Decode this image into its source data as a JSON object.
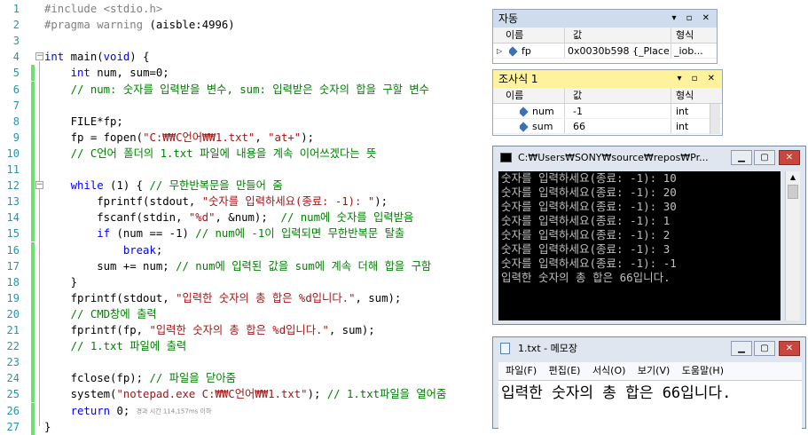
{
  "editor": {
    "line_numbers": [
      "1",
      "2",
      "3",
      "4",
      "5",
      "6",
      "7",
      "8",
      "9",
      "10",
      "11",
      "12",
      "13",
      "14",
      "15",
      "16",
      "17",
      "18",
      "19",
      "20",
      "21",
      "22",
      "23",
      "24",
      "25",
      "26",
      "27"
    ],
    "lines": [
      [
        {
          "t": "#include <stdio.h>",
          "c": "pp"
        }
      ],
      [
        {
          "t": "#pragma warning ",
          "c": "pp"
        },
        {
          "t": "(aisble:4996)",
          "c": ""
        }
      ],
      [],
      [
        {
          "t": "int",
          "c": "kw"
        },
        {
          "t": " main(",
          "c": ""
        },
        {
          "t": "void",
          "c": "kw"
        },
        {
          "t": ") {",
          "c": ""
        }
      ],
      [
        {
          "t": "    ",
          "c": ""
        },
        {
          "t": "int",
          "c": "kw"
        },
        {
          "t": " num, sum=0;",
          "c": ""
        }
      ],
      [
        {
          "t": "    // num: 숫자를 입력받을 변수, sum: 입력받은 숫자의 합을 구할 변수",
          "c": "cmt"
        }
      ],
      [],
      [
        {
          "t": "    FILE*fp;",
          "c": ""
        }
      ],
      [
        {
          "t": "    fp = fopen(",
          "c": ""
        },
        {
          "t": "\"C:₩₩C언어₩₩1.txt\"",
          "c": "str"
        },
        {
          "t": ", ",
          "c": ""
        },
        {
          "t": "\"at+\"",
          "c": "str"
        },
        {
          "t": ");",
          "c": ""
        }
      ],
      [
        {
          "t": "    // C언어 폴더의 1.txt 파일에 내용을 계속 이어쓰겠다는 뜻",
          "c": "cmt"
        }
      ],
      [],
      [
        {
          "t": "    ",
          "c": ""
        },
        {
          "t": "while",
          "c": "kw"
        },
        {
          "t": " (1) { ",
          "c": ""
        },
        {
          "t": "// 무한반복문을 만들어 줌",
          "c": "cmt"
        }
      ],
      [
        {
          "t": "        fprintf(stdout, ",
          "c": ""
        },
        {
          "t": "\"숫자를 입력하세요(종료: -1): \"",
          "c": "str"
        },
        {
          "t": ");",
          "c": ""
        }
      ],
      [
        {
          "t": "        fscanf(stdin, ",
          "c": ""
        },
        {
          "t": "\"%d\"",
          "c": "str"
        },
        {
          "t": ", &num);  ",
          "c": ""
        },
        {
          "t": "// num에 숫자를 입력받음",
          "c": "cmt"
        }
      ],
      [
        {
          "t": "        ",
          "c": ""
        },
        {
          "t": "if",
          "c": "kw"
        },
        {
          "t": " (num == -1) ",
          "c": ""
        },
        {
          "t": "// num에 -1이 입력되면 무한반복문 탈출",
          "c": "cmt"
        }
      ],
      [
        {
          "t": "            ",
          "c": ""
        },
        {
          "t": "break",
          "c": "kw"
        },
        {
          "t": ";",
          "c": ""
        }
      ],
      [
        {
          "t": "        sum += num; ",
          "c": ""
        },
        {
          "t": "// num에 입력된 값을 sum에 계속 더해 합을 구함",
          "c": "cmt"
        }
      ],
      [
        {
          "t": "    }",
          "c": ""
        }
      ],
      [
        {
          "t": "    fprintf(stdout, ",
          "c": ""
        },
        {
          "t": "\"입력한 숫자의 총 합은 %d입니다.\"",
          "c": "str"
        },
        {
          "t": ", sum);",
          "c": ""
        }
      ],
      [
        {
          "t": "    // CMD창에 출력",
          "c": "cmt"
        }
      ],
      [
        {
          "t": "    fprintf(fp, ",
          "c": ""
        },
        {
          "t": "\"입력한 숫자의 총 합은 %d입니다.\"",
          "c": "str"
        },
        {
          "t": ", sum);",
          "c": ""
        }
      ],
      [
        {
          "t": "    // 1.txt 파일에 출력",
          "c": "cmt"
        }
      ],
      [],
      [
        {
          "t": "    fclose(fp); ",
          "c": ""
        },
        {
          "t": "// 파일을 닫아줌",
          "c": "cmt"
        }
      ],
      [
        {
          "t": "    system(",
          "c": ""
        },
        {
          "t": "\"notepad.exe C:₩₩C언어₩₩1.txt\"",
          "c": "str"
        },
        {
          "t": "); ",
          "c": ""
        },
        {
          "t": "// 1.txt파일을 열어줌",
          "c": "cmt"
        }
      ],
      [
        {
          "t": "    ",
          "c": ""
        },
        {
          "t": "return",
          "c": "kw"
        },
        {
          "t": " 0; ",
          "c": ""
        },
        {
          "t": "경과 시간 114,157ms 이하",
          "c": "hint"
        }
      ],
      [
        {
          "t": "}",
          "c": ""
        }
      ]
    ]
  },
  "autos": {
    "title": "자동",
    "col_name": "이름",
    "col_value": "값",
    "col_type": "형식",
    "row_name": "fp",
    "row_value": "0x0030b598 {_Place...",
    "row_type": "_iob..."
  },
  "watch": {
    "title": "조사식 1",
    "col_name": "이름",
    "col_value": "값",
    "col_type": "형식",
    "rows": [
      {
        "name": "num",
        "value": "-1",
        "type": "int"
      },
      {
        "name": "sum",
        "value": "66",
        "type": "int"
      }
    ]
  },
  "console": {
    "title": "C:₩Users₩SONY₩source₩repos₩Pr...",
    "lines": [
      "숫자를 입력하세요(종료: -1): 10",
      "숫자를 입력하세요(종료: -1): 20",
      "숫자를 입력하세요(종료: -1): 30",
      "숫자를 입력하세요(종료: -1): 1",
      "숫자를 입력하세요(종료: -1): 2",
      "숫자를 입력하세요(종료: -1): 3",
      "숫자를 입력하세요(종료: -1): -1",
      "입력한 숫자의 총 합은 66입니다."
    ]
  },
  "notepad": {
    "title": "1.txt - 메모장",
    "menu": [
      "파일(F)",
      "편집(E)",
      "서식(O)",
      "보기(V)",
      "도움말(H)"
    ],
    "text": "입력한 숫자의 총 합은 66입니다."
  },
  "colors": {
    "keyword": "#0000ff",
    "string": "#a31515",
    "comment": "#008000",
    "line_number": "#2b91af",
    "change_bar": "#6ce26c",
    "tool_title": "#ffefb0",
    "tool_title_active": "#fff29d",
    "console_bg": "#000000"
  }
}
